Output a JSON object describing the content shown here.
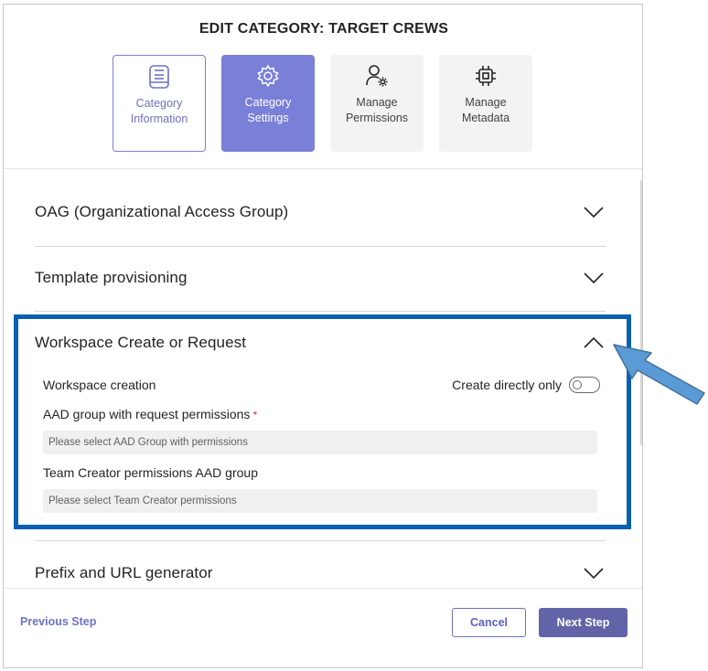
{
  "dialog": {
    "title": "EDIT CATEGORY: TARGET CREWS"
  },
  "steps": [
    {
      "label": "Category Information",
      "icon": "category-info-icon",
      "state": "done"
    },
    {
      "label": "Category Settings",
      "icon": "settings-gear-icon",
      "state": "active"
    },
    {
      "label": "Manage Permissions",
      "icon": "person-gear-icon",
      "state": "pending"
    },
    {
      "label": "Manage Metadata",
      "icon": "chip-icon",
      "state": "pending"
    }
  ],
  "sections": {
    "oag": {
      "title": "OAG (Organizational Access Group)",
      "expanded": false
    },
    "template": {
      "title": "Template provisioning",
      "expanded": false
    },
    "workspace": {
      "title": "Workspace Create or Request",
      "expanded": true,
      "creation_label": "Workspace creation",
      "toggle_label": "Create directly only",
      "toggle_on": false,
      "aad_label": "AAD group with request permissions",
      "aad_required_mark": "*",
      "aad_placeholder": "Please select AAD Group with permissions",
      "creator_label": "Team Creator permissions AAD group",
      "creator_placeholder": "Please select Team Creator permissions"
    },
    "prefix": {
      "title": "Prefix and URL generator",
      "expanded": false
    }
  },
  "footer": {
    "previous_label": "Previous Step",
    "cancel_label": "Cancel",
    "next_label": "Next Step"
  },
  "colors": {
    "accent": "#6264a7",
    "active_step": "#7a7fd8",
    "highlight_border": "#0a5fb0",
    "callout_arrow": "#5b9bd5"
  }
}
